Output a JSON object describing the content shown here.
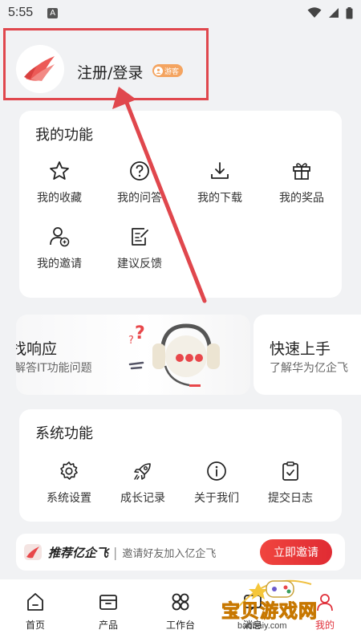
{
  "status_bar": {
    "time": "5:55",
    "notification_letter": "A"
  },
  "profile": {
    "login_label": "注册/登录",
    "guest_badge": "游客"
  },
  "my_functions": {
    "title": "我的功能",
    "items": [
      {
        "label": "我的收藏",
        "icon": "star-icon"
      },
      {
        "label": "我的问答",
        "icon": "question-icon"
      },
      {
        "label": "我的下载",
        "icon": "download-icon"
      },
      {
        "label": "我的奖品",
        "icon": "gift-icon"
      },
      {
        "label": "我的邀请",
        "icon": "invite-icon"
      },
      {
        "label": "建议反馈",
        "icon": "feedback-icon"
      }
    ]
  },
  "banners": [
    {
      "title": "找响应",
      "subtitle": "解答IT功能问题"
    },
    {
      "title": "快速上手",
      "subtitle": "了解华为亿企飞"
    }
  ],
  "system_functions": {
    "title": "系统功能",
    "items": [
      {
        "label": "系统设置",
        "icon": "gear-icon"
      },
      {
        "label": "成长记录",
        "icon": "rocket-icon"
      },
      {
        "label": "关于我们",
        "icon": "info-icon"
      },
      {
        "label": "提交日志",
        "icon": "log-icon"
      }
    ]
  },
  "invite": {
    "title": "推荐亿企飞",
    "description": "邀请好友加入亿企飞",
    "button": "立即邀请"
  },
  "tabs": [
    {
      "label": "首页",
      "icon": "home-icon"
    },
    {
      "label": "产品",
      "icon": "product-icon"
    },
    {
      "label": "工作台",
      "icon": "workbench-icon"
    },
    {
      "label": "消息",
      "icon": "message-icon"
    },
    {
      "label": "我的",
      "icon": "profile-icon"
    }
  ],
  "watermark": {
    "text": "宝贝游戏网",
    "url": "baobeiy.com"
  },
  "colors": {
    "accent": "#e0303a",
    "annotation": "#e0474d",
    "guest_badge": "#f4a460"
  }
}
